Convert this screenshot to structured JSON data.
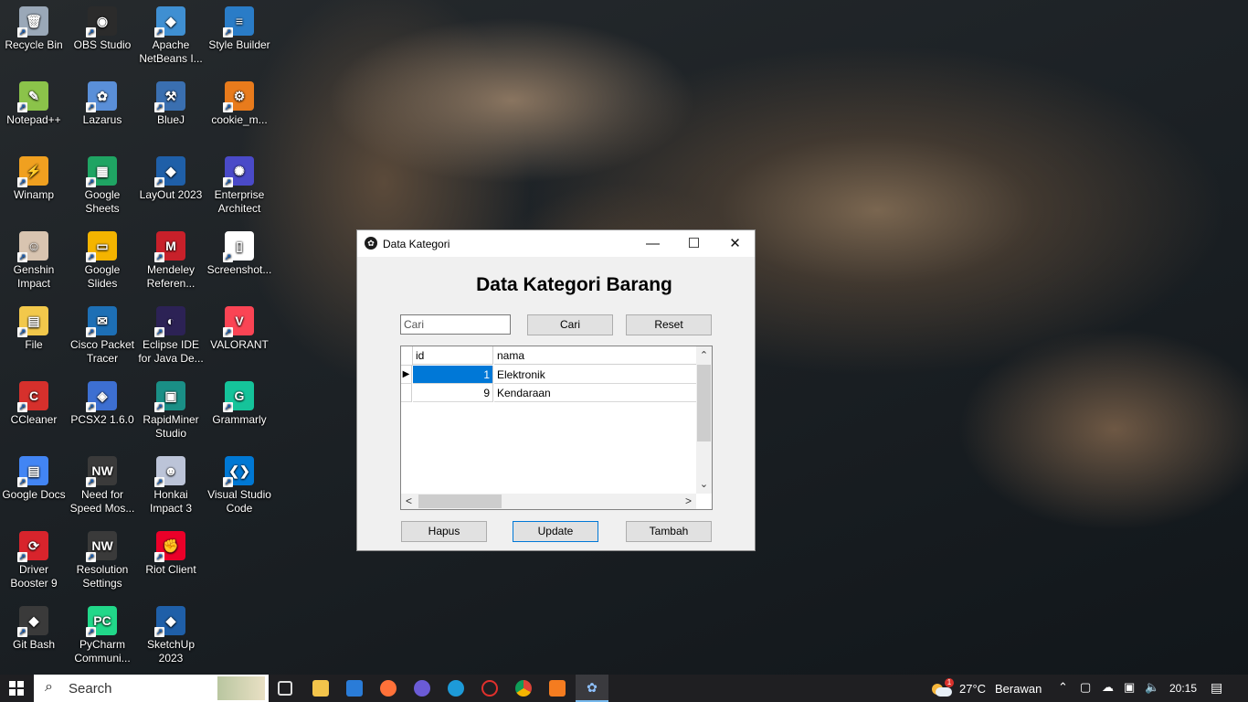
{
  "desktop": {
    "icons": [
      {
        "label": "Recycle Bin",
        "color": "#9aa8b8",
        "glyph": "🗑"
      },
      {
        "label": "OBS Studio",
        "color": "#2b2b2b",
        "glyph": "◉"
      },
      {
        "label": "Apache NetBeans I...",
        "color": "#3f8fd2",
        "glyph": "◆"
      },
      {
        "label": "Style Builder",
        "color": "#2a7cc7",
        "glyph": "≡"
      },
      {
        "label": "Notepad++",
        "color": "#8bc34a",
        "glyph": "✎"
      },
      {
        "label": "Lazarus",
        "color": "#5a8fd8",
        "glyph": "✿"
      },
      {
        "label": "BlueJ",
        "color": "#3a6fb0",
        "glyph": "⚒"
      },
      {
        "label": "cookie_m...",
        "color": "#e87b1c",
        "glyph": "⚙"
      },
      {
        "label": "Winamp",
        "color": "#f0a020",
        "glyph": "⚡"
      },
      {
        "label": "Google Sheets",
        "color": "#1fa463",
        "glyph": "▦"
      },
      {
        "label": "LayOut 2023",
        "color": "#1f5fa8",
        "glyph": "◆"
      },
      {
        "label": "Enterprise Architect",
        "color": "#4a4ac8",
        "glyph": "✺"
      },
      {
        "label": "Genshin Impact",
        "color": "#d8c4b0",
        "glyph": "☺"
      },
      {
        "label": "Google Slides",
        "color": "#f4b400",
        "glyph": "▭"
      },
      {
        "label": "Mendeley Referen...",
        "color": "#c8202a",
        "glyph": "M"
      },
      {
        "label": "Screenshot...",
        "color": "#ffffff",
        "glyph": "▯"
      },
      {
        "label": "File",
        "color": "#f2c84b",
        "glyph": "▤"
      },
      {
        "label": "Cisco Packet Tracer",
        "color": "#1d6fb5",
        "glyph": "✉"
      },
      {
        "label": "Eclipse IDE for Java De...",
        "color": "#2c2255",
        "glyph": "◐"
      },
      {
        "label": "VALORANT",
        "color": "#fa4454",
        "glyph": "V"
      },
      {
        "label": "CCleaner",
        "color": "#d6302c",
        "glyph": "C"
      },
      {
        "label": "PCSX2 1.6.0",
        "color": "#3d6fd1",
        "glyph": "◈"
      },
      {
        "label": "RapidMiner Studio",
        "color": "#1a8f86",
        "glyph": "▣"
      },
      {
        "label": "Grammarly",
        "color": "#15c39a",
        "glyph": "G"
      },
      {
        "label": "Google Docs",
        "color": "#4285f4",
        "glyph": "▤"
      },
      {
        "label": "Need for Speed Mos...",
        "color": "#3a3a3a",
        "glyph": "NW"
      },
      {
        "label": "Honkai Impact 3",
        "color": "#bcc4d8",
        "glyph": "☻"
      },
      {
        "label": "Visual Studio Code",
        "color": "#0078d4",
        "glyph": "❮❯"
      },
      {
        "label": "Driver Booster 9",
        "color": "#d8242c",
        "glyph": "⟳"
      },
      {
        "label": "Resolution Settings",
        "color": "#3a3a3a",
        "glyph": "NW"
      },
      {
        "label": "Riot Client",
        "color": "#eb0029",
        "glyph": "✊"
      },
      {
        "label": "",
        "color": "",
        "glyph": ""
      },
      {
        "label": "Git Bash",
        "color": "#3a3a3a",
        "glyph": "◆"
      },
      {
        "label": "PyCharm Communi...",
        "color": "#21d789",
        "glyph": "PC"
      },
      {
        "label": "SketchUp 2023",
        "color": "#1f5fa8",
        "glyph": "◆"
      },
      {
        "label": "",
        "color": "",
        "glyph": ""
      }
    ]
  },
  "window": {
    "title": "Data Kategori",
    "minimize_glyph": "—",
    "maximize_glyph": "☐",
    "close_glyph": "✕",
    "heading": "Data Kategori Barang",
    "search_placeholder": "Cari",
    "search_button": "Cari",
    "reset_button": "Reset",
    "table": {
      "columns": [
        "id",
        "nama"
      ],
      "rows": [
        {
          "id": "1",
          "nama": "Elektronik",
          "selected": true
        },
        {
          "id": "9",
          "nama": "Kendaraan",
          "selected": false
        }
      ],
      "row_marker": "▶",
      "scroll_up": "⌃",
      "scroll_down": "⌄",
      "scroll_left": "<",
      "scroll_right": ">"
    },
    "delete_button": "Hapus",
    "update_button": "Update",
    "add_button": "Tambah"
  },
  "taskbar": {
    "search_placeholder": "Search",
    "weather_temp": "27°C",
    "weather_text": "Berawan",
    "weather_badge": "1",
    "time": "20:15"
  }
}
